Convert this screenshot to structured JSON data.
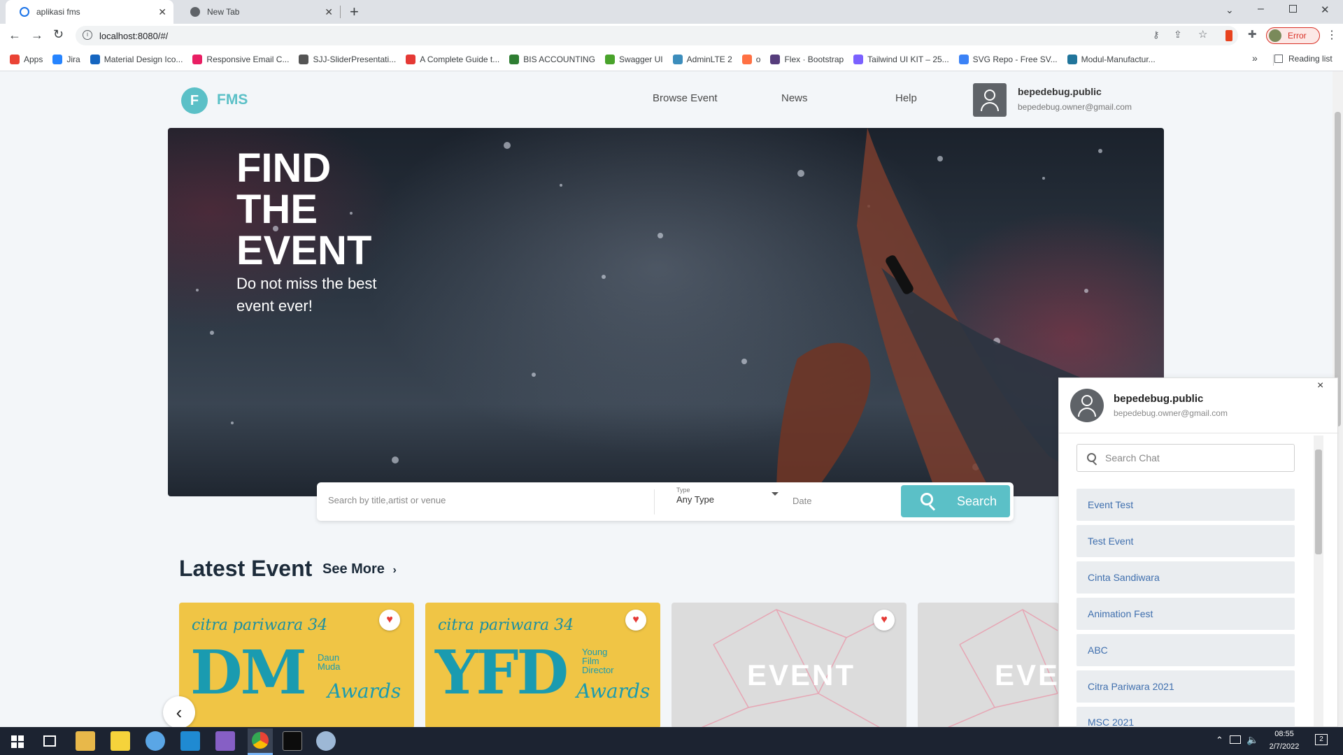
{
  "browser": {
    "tabs": [
      {
        "title": "aplikasi fms",
        "active": true
      },
      {
        "title": "New Tab",
        "active": false
      }
    ],
    "new_tab_symbol": "+",
    "url": "localhost:8080/#/",
    "profile_label": "Error",
    "bookmarks": [
      {
        "label": "Apps",
        "color": "#ea4335"
      },
      {
        "label": "Jira",
        "color": "#2684ff"
      },
      {
        "label": "Material Design Ico...",
        "color": "#1565c0"
      },
      {
        "label": "Responsive Email C...",
        "color": "#e91e63"
      },
      {
        "label": "SJJ-SliderPresentati...",
        "color": "#555555"
      },
      {
        "label": "A Complete Guide t...",
        "color": "#e53935"
      },
      {
        "label": "BIS ACCOUNTING",
        "color": "#2e7d32"
      },
      {
        "label": "Swagger UI",
        "color": "#49a32b"
      },
      {
        "label": "AdminLTE 2",
        "color": "#3c8dbc"
      },
      {
        "label": "o",
        "color": "#ff7043"
      },
      {
        "label": "Flex · Bootstrap",
        "color": "#563d7c"
      },
      {
        "label": "Tailwind UI KIT – 25...",
        "color": "#7b61ff"
      },
      {
        "label": "SVG Repo - Free SV...",
        "color": "#3b82f6"
      },
      {
        "label": "Modul-Manufactur...",
        "color": "#21759b"
      }
    ],
    "more_bookmarks": "»",
    "reading_list": "Reading list"
  },
  "app": {
    "logo_letter": "F",
    "logo_text": "FMS",
    "brand_color": "#5bc0c7",
    "nav": [
      "Browse Event",
      "News",
      "Help"
    ],
    "user": {
      "name": "bepedebug.public",
      "email": "bepedebug.owner@gmail.com"
    }
  },
  "hero": {
    "title_lines": [
      "FIND",
      "THE",
      "EVENT"
    ],
    "subtitle": "Do not miss the best event ever!"
  },
  "search": {
    "keyword_placeholder": "Search by title,artist or venue",
    "type_label": "Type",
    "type_value": "Any Type",
    "date_placeholder": "Date",
    "button_label": "Search"
  },
  "latest": {
    "title": "Latest Event",
    "see_more": "See More",
    "cards": [
      {
        "logo": "citra pariwara 34",
        "big": "DM",
        "small_lines": [
          "Daun",
          "Muda"
        ],
        "awards": "Awards",
        "bg": "#f0c545",
        "favorite": true
      },
      {
        "logo": "citra pariwara 34",
        "big": "YFD",
        "small_lines": [
          "Young",
          "Film",
          "Director"
        ],
        "awards": "Awards",
        "bg": "#f0c545",
        "favorite": true
      },
      {
        "placeholder_text": "EVENT",
        "bg": "#dcdcdc",
        "favorite": true
      },
      {
        "placeholder_text": "EVEN",
        "bg": "#dcdcdc",
        "favorite": false
      }
    ]
  },
  "chat": {
    "user": {
      "name": "bepedebug.public",
      "email": "bepedebug.owner@gmail.com"
    },
    "close_symbol": "×",
    "search_placeholder": "Search Chat",
    "rooms": [
      "Event Test",
      "Test Event",
      "Cinta Sandiwara",
      "Animation Fest",
      "ABC",
      "Citra Pariwara 2021",
      "MSC 2021"
    ]
  },
  "taskbar": {
    "time": "08:55",
    "date": "2/7/2022",
    "notification_count": "2"
  }
}
